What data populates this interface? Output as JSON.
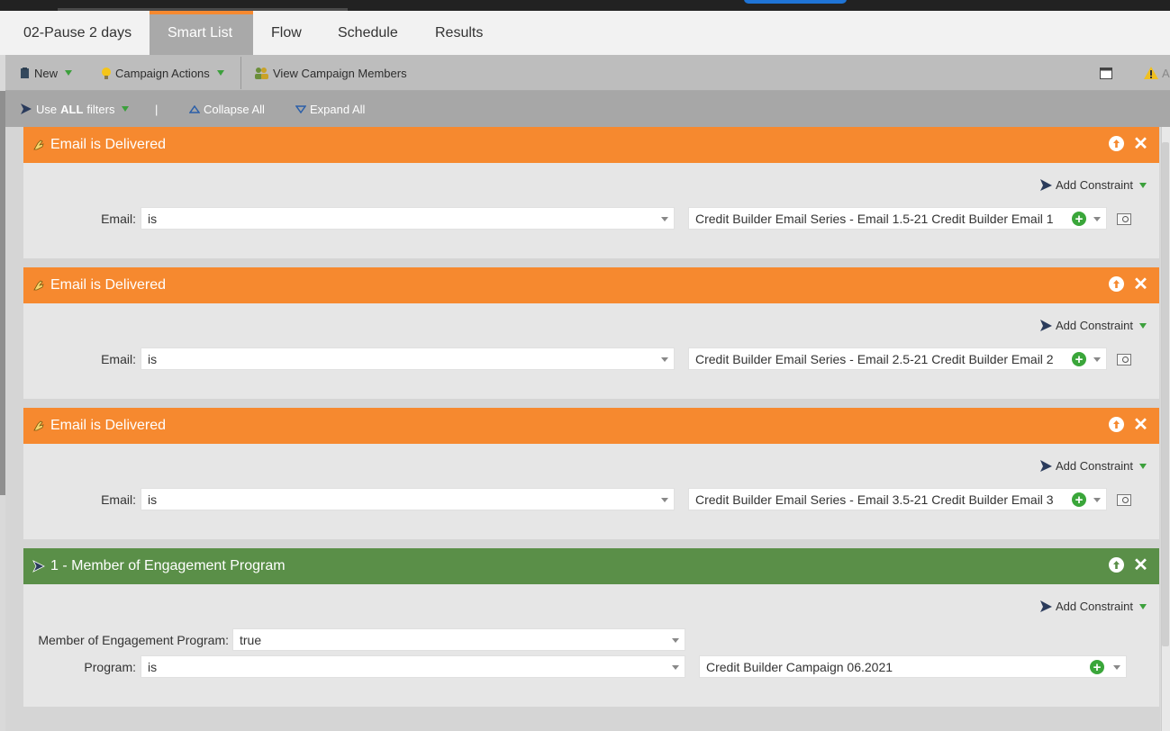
{
  "tabs": [
    {
      "label": "02-Pause 2 days"
    },
    {
      "label": "Smart List",
      "active": true
    },
    {
      "label": "Flow"
    },
    {
      "label": "Schedule"
    },
    {
      "label": "Results"
    }
  ],
  "toolbar": {
    "new_label": "New",
    "campaign_actions_label": "Campaign Actions",
    "view_members_label": "View Campaign Members",
    "right_partial_label": "Ac"
  },
  "filterbar": {
    "use_prefix": "Use ",
    "use_all": "ALL",
    "use_suffix": " filters",
    "separator": "|",
    "collapse_label": "Collapse All",
    "expand_label": "Expand All"
  },
  "colors": {
    "orange_header": "#f6892f",
    "green_header": "#5a8f48",
    "active_tab": "#a9a9a9",
    "plus_green": "#3aa63a"
  },
  "filters": [
    {
      "title": "Email is Delivered",
      "add_constraint": "Add Constraint",
      "label": "Email:",
      "operator": "is",
      "value": "Credit Builder Email Series - Email 1.5-21 Credit Builder Email 1"
    },
    {
      "title": "Email is Delivered",
      "add_constraint": "Add Constraint",
      "label": "Email:",
      "operator": "is",
      "value": "Credit Builder Email Series - Email 2.5-21 Credit Builder Email 2"
    },
    {
      "title": "Email is Delivered",
      "add_constraint": "Add Constraint",
      "label": "Email:",
      "operator": "is",
      "value": "Credit Builder Email Series - Email 3.5-21 Credit Builder Email 3"
    }
  ],
  "engagement": {
    "title": "1 - Member of Engagement Program",
    "add_constraint": "Add Constraint",
    "member_label": "Member of Engagement Program:",
    "member_value": "true",
    "program_label": "Program:",
    "program_operator": "is",
    "program_value": "Credit Builder Campaign 06.2021"
  }
}
